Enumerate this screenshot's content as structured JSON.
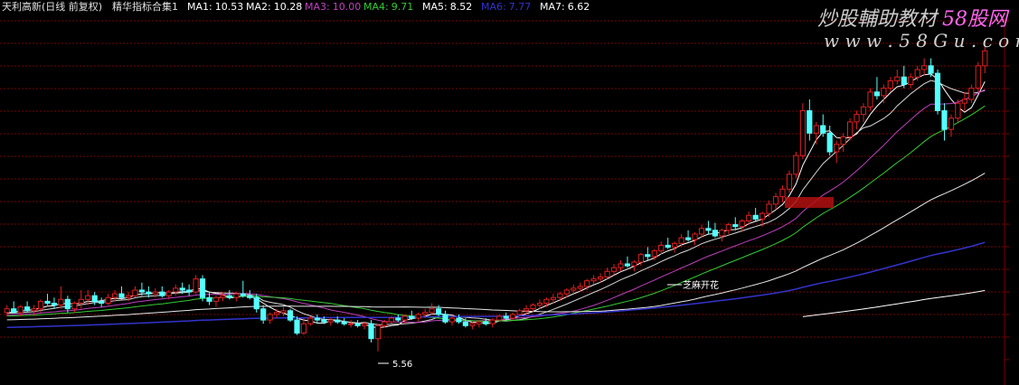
{
  "header": {
    "stock_name": "天利高新(日线 前复权)",
    "indicator_set": "精华指标合集1",
    "ma_readouts": [
      {
        "label": "MA1:",
        "value": "10.53",
        "color": "#ffffff"
      },
      {
        "label": "MA2:",
        "value": "10.28",
        "color": "#ffffff"
      },
      {
        "label": "MA3:",
        "value": "10.00",
        "color": "#c040c0"
      },
      {
        "label": "MA4:",
        "value": "9.71",
        "color": "#33cc33"
      },
      {
        "label": "MA5:",
        "value": "8.52",
        "color": "#ffffff"
      },
      {
        "label": "MA6:",
        "value": "7.77",
        "color": "#3333cc"
      },
      {
        "label": "MA7:",
        "value": "6.62",
        "color": "#ffffff"
      }
    ]
  },
  "watermark": {
    "line1": "炒股輔助教材",
    "line1_site": "58股网",
    "line2": "w w w . 5 8 G u . c o m"
  },
  "annotations": {
    "low_marker": "5.56",
    "pattern_label": "芝麻开花"
  },
  "colors": {
    "background": "#000000",
    "grid": "#7a0000",
    "up_candle": "#e02020",
    "down_candle": "#54ffff",
    "text": "#e0e0e0"
  },
  "chart_data": {
    "type": "candlestick",
    "title": "",
    "ylim": [
      5.0,
      13.8
    ],
    "grid": true,
    "bar_count": 152,
    "ohlc": [
      [
        6.6,
        6.8,
        6.5,
        6.7
      ],
      [
        6.7,
        6.9,
        6.6,
        6.6
      ],
      [
        6.6,
        6.8,
        6.5,
        6.75
      ],
      [
        6.75,
        6.9,
        6.6,
        6.65
      ],
      [
        6.65,
        6.8,
        6.5,
        6.7
      ],
      [
        6.7,
        6.95,
        6.6,
        6.9
      ],
      [
        6.9,
        7.1,
        6.8,
        6.85
      ],
      [
        6.85,
        7.0,
        6.7,
        6.8
      ],
      [
        6.8,
        7.3,
        6.7,
        6.95
      ],
      [
        6.95,
        7.05,
        6.6,
        6.7
      ],
      [
        6.7,
        6.9,
        6.6,
        6.85
      ],
      [
        6.85,
        7.2,
        6.7,
        6.95
      ],
      [
        6.95,
        7.2,
        6.8,
        7.05
      ],
      [
        7.05,
        7.15,
        6.8,
        6.9
      ],
      [
        6.9,
        7.0,
        6.75,
        6.85
      ],
      [
        6.85,
        7.1,
        6.8,
        7.0
      ],
      [
        7.0,
        7.2,
        6.9,
        7.1
      ],
      [
        7.1,
        7.3,
        6.95,
        7.0
      ],
      [
        7.0,
        7.15,
        6.9,
        7.05
      ],
      [
        7.05,
        7.3,
        7.0,
        7.2
      ],
      [
        7.2,
        7.4,
        7.05,
        7.15
      ],
      [
        7.15,
        7.3,
        7.0,
        7.1
      ],
      [
        7.1,
        7.25,
        7.0,
        7.15
      ],
      [
        7.15,
        7.3,
        7.0,
        7.05
      ],
      [
        7.05,
        7.2,
        6.95,
        7.15
      ],
      [
        7.15,
        7.35,
        7.05,
        7.25
      ],
      [
        7.25,
        7.4,
        7.1,
        7.2
      ],
      [
        7.2,
        7.35,
        7.05,
        7.15
      ],
      [
        7.15,
        7.6,
        7.1,
        7.5
      ],
      [
        7.5,
        7.6,
        6.9,
        7.0
      ],
      [
        7.0,
        7.15,
        6.8,
        6.9
      ],
      [
        6.9,
        7.05,
        6.75,
        7.0
      ],
      [
        7.0,
        7.15,
        6.9,
        7.05
      ],
      [
        7.05,
        7.2,
        6.95,
        7.0
      ],
      [
        7.0,
        7.15,
        6.9,
        7.1
      ],
      [
        7.1,
        7.45,
        7.0,
        7.05
      ],
      [
        7.05,
        7.2,
        6.95,
        7.0
      ],
      [
        7.0,
        7.1,
        6.6,
        6.7
      ],
      [
        6.7,
        6.8,
        6.3,
        6.4
      ],
      [
        6.4,
        6.6,
        6.3,
        6.55
      ],
      [
        6.55,
        6.7,
        6.45,
        6.6
      ],
      [
        6.6,
        6.75,
        6.5,
        6.65
      ],
      [
        6.65,
        6.7,
        6.35,
        6.4
      ],
      [
        6.4,
        6.5,
        6.0,
        6.05
      ],
      [
        6.05,
        6.45,
        6.0,
        6.3
      ],
      [
        6.3,
        6.5,
        6.25,
        6.45
      ],
      [
        6.45,
        6.55,
        6.3,
        6.4
      ],
      [
        6.4,
        6.5,
        6.3,
        6.35
      ],
      [
        6.35,
        6.45,
        6.25,
        6.4
      ],
      [
        6.4,
        6.5,
        6.3,
        6.35
      ],
      [
        6.35,
        6.45,
        6.25,
        6.3
      ],
      [
        6.3,
        6.4,
        6.2,
        6.3
      ],
      [
        6.3,
        6.4,
        6.2,
        6.25
      ],
      [
        6.25,
        6.35,
        6.15,
        6.3
      ],
      [
        6.3,
        6.4,
        5.8,
        5.9
      ],
      [
        5.9,
        6.3,
        5.56,
        6.25
      ],
      [
        6.25,
        6.4,
        6.2,
        6.35
      ],
      [
        6.35,
        6.5,
        6.3,
        6.45
      ],
      [
        6.45,
        6.55,
        6.35,
        6.4
      ],
      [
        6.4,
        6.55,
        6.3,
        6.5
      ],
      [
        6.5,
        6.65,
        6.4,
        6.45
      ],
      [
        6.45,
        6.6,
        6.35,
        6.55
      ],
      [
        6.55,
        6.7,
        6.45,
        6.6
      ],
      [
        6.6,
        6.85,
        6.55,
        6.7
      ],
      [
        6.7,
        6.8,
        6.5,
        6.55
      ],
      [
        6.55,
        6.65,
        6.3,
        6.35
      ],
      [
        6.35,
        6.5,
        6.25,
        6.45
      ],
      [
        6.45,
        6.55,
        6.3,
        6.35
      ],
      [
        6.35,
        6.45,
        6.2,
        6.25
      ],
      [
        6.25,
        6.35,
        6.15,
        6.3
      ],
      [
        6.3,
        6.4,
        6.2,
        6.35
      ],
      [
        6.35,
        6.45,
        6.25,
        6.3
      ],
      [
        6.3,
        6.45,
        6.2,
        6.4
      ],
      [
        6.4,
        6.55,
        6.35,
        6.5
      ],
      [
        6.5,
        6.6,
        6.4,
        6.45
      ],
      [
        6.45,
        6.6,
        6.4,
        6.55
      ],
      [
        6.55,
        6.7,
        6.5,
        6.65
      ],
      [
        6.65,
        6.8,
        6.55,
        6.7
      ],
      [
        6.7,
        6.85,
        6.6,
        6.8
      ],
      [
        6.8,
        6.95,
        6.7,
        6.85
      ],
      [
        6.85,
        7.0,
        6.75,
        6.95
      ],
      [
        6.95,
        7.1,
        6.85,
        7.0
      ],
      [
        7.0,
        7.15,
        6.9,
        7.1
      ],
      [
        7.1,
        7.25,
        7.0,
        7.2
      ],
      [
        7.2,
        7.35,
        7.1,
        7.25
      ],
      [
        7.25,
        7.4,
        7.15,
        7.3
      ],
      [
        7.3,
        7.5,
        7.2,
        7.45
      ],
      [
        7.45,
        7.6,
        7.35,
        7.5
      ],
      [
        7.5,
        7.65,
        7.4,
        7.55
      ],
      [
        7.55,
        7.8,
        7.5,
        7.7
      ],
      [
        7.7,
        7.9,
        7.6,
        7.8
      ],
      [
        7.8,
        8.0,
        7.7,
        7.9
      ],
      [
        7.9,
        8.1,
        7.8,
        7.85
      ],
      [
        7.85,
        8.0,
        7.7,
        7.95
      ],
      [
        7.95,
        8.2,
        7.85,
        8.15
      ],
      [
        8.15,
        8.35,
        8.0,
        8.1
      ],
      [
        8.1,
        8.3,
        8.0,
        8.25
      ],
      [
        8.25,
        8.5,
        8.15,
        8.4
      ],
      [
        8.4,
        8.6,
        8.3,
        8.35
      ],
      [
        8.35,
        8.5,
        8.2,
        8.45
      ],
      [
        8.45,
        8.7,
        8.35,
        8.6
      ],
      [
        8.6,
        8.8,
        8.5,
        8.55
      ],
      [
        8.55,
        8.75,
        8.4,
        8.7
      ],
      [
        8.7,
        8.95,
        8.6,
        8.85
      ],
      [
        8.85,
        9.05,
        8.7,
        8.8
      ],
      [
        8.8,
        9.0,
        8.6,
        8.65
      ],
      [
        8.65,
        8.85,
        8.5,
        8.8
      ],
      [
        8.8,
        9.0,
        8.7,
        8.95
      ],
      [
        8.95,
        9.15,
        8.8,
        8.9
      ],
      [
        8.9,
        9.1,
        8.75,
        9.05
      ],
      [
        9.05,
        9.3,
        8.95,
        9.2
      ],
      [
        9.2,
        9.4,
        9.05,
        9.1
      ],
      [
        9.1,
        9.3,
        8.9,
        9.25
      ],
      [
        9.25,
        9.6,
        9.15,
        9.5
      ],
      [
        9.5,
        9.8,
        9.35,
        9.7
      ],
      [
        9.7,
        10.0,
        9.55,
        9.9
      ],
      [
        9.9,
        10.4,
        9.8,
        10.3
      ],
      [
        10.3,
        10.9,
        10.2,
        10.8
      ],
      [
        10.8,
        12.2,
        10.7,
        12.0
      ],
      [
        12.0,
        12.3,
        11.2,
        11.4
      ],
      [
        11.4,
        11.7,
        11.1,
        11.6
      ],
      [
        11.6,
        11.9,
        11.3,
        11.4
      ],
      [
        11.4,
        11.6,
        10.8,
        10.9
      ],
      [
        10.9,
        11.2,
        10.6,
        11.1
      ],
      [
        11.1,
        11.4,
        10.9,
        11.3
      ],
      [
        11.3,
        11.8,
        11.2,
        11.7
      ],
      [
        11.7,
        12.0,
        11.5,
        11.9
      ],
      [
        11.9,
        12.2,
        11.7,
        12.1
      ],
      [
        12.1,
        12.6,
        12.0,
        12.5
      ],
      [
        12.5,
        12.9,
        12.3,
        12.4
      ],
      [
        12.4,
        12.7,
        12.2,
        12.6
      ],
      [
        12.6,
        12.9,
        12.5,
        12.8
      ],
      [
        12.8,
        13.1,
        12.7,
        12.9
      ],
      [
        12.9,
        13.2,
        12.6,
        12.7
      ],
      [
        12.7,
        13.0,
        12.6,
        12.9
      ],
      [
        12.9,
        13.2,
        12.8,
        13.1
      ],
      [
        13.1,
        13.4,
        12.95,
        13.2
      ],
      [
        13.2,
        13.4,
        12.9,
        13.0
      ],
      [
        13.0,
        13.1,
        11.9,
        12.0
      ],
      [
        12.0,
        12.2,
        11.2,
        11.5
      ],
      [
        11.5,
        11.9,
        11.3,
        11.8
      ],
      [
        11.8,
        12.3,
        11.7,
        12.2
      ],
      [
        12.2,
        12.5,
        12.0,
        12.3
      ],
      [
        12.3,
        12.7,
        12.2,
        12.6
      ],
      [
        12.6,
        13.3,
        12.5,
        13.2
      ],
      [
        13.2,
        13.8,
        13.0,
        13.6
      ]
    ],
    "series": [
      {
        "key": "MA1",
        "color": "#ffffff",
        "width": 1,
        "values": []
      },
      {
        "key": "MA2",
        "color": "#d8d8d8",
        "width": 1,
        "values": []
      },
      {
        "key": "MA3",
        "color": "#c040c0",
        "width": 1,
        "values": []
      },
      {
        "key": "MA4",
        "color": "#33cc33",
        "width": 1,
        "values": []
      },
      {
        "key": "MA5",
        "color": "#e8e8e8",
        "width": 1,
        "values": []
      },
      {
        "key": "MA6",
        "color": "#3333cc",
        "width": 1.5,
        "values": []
      },
      {
        "key": "MA7",
        "color": "#ffffff",
        "width": 1,
        "values": []
      }
    ]
  }
}
